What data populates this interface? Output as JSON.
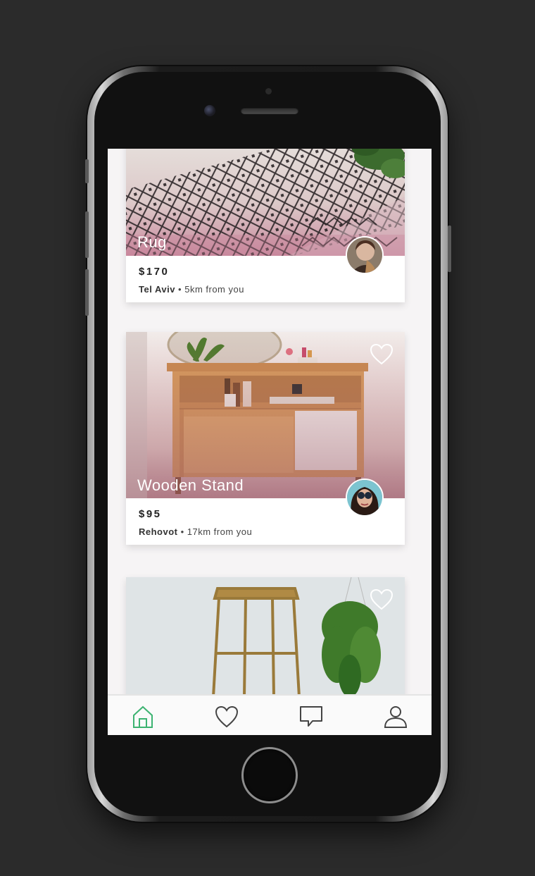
{
  "colors": {
    "accent": "#3cb371",
    "icon_inactive": "#444444",
    "background": "#2b2b2b",
    "screen_bg": "#f6f4f5"
  },
  "listings": [
    {
      "title": "Rug",
      "price": "$170",
      "city": "Tel Aviv",
      "distance": "5km from you",
      "favorite_icon": "heart-outline-icon"
    },
    {
      "title": "Wooden Stand",
      "price": "$95",
      "city": "Rehovot",
      "distance": "17km from you",
      "favorite_icon": "heart-outline-icon"
    },
    {
      "title": "",
      "favorite_icon": "heart-outline-icon"
    }
  ],
  "tabbar": {
    "tabs": [
      {
        "name": "home",
        "icon": "home-icon",
        "active": true
      },
      {
        "name": "favorites",
        "icon": "heart-icon",
        "active": false
      },
      {
        "name": "messages",
        "icon": "chat-icon",
        "active": false
      },
      {
        "name": "profile",
        "icon": "user-icon",
        "active": false
      }
    ]
  }
}
